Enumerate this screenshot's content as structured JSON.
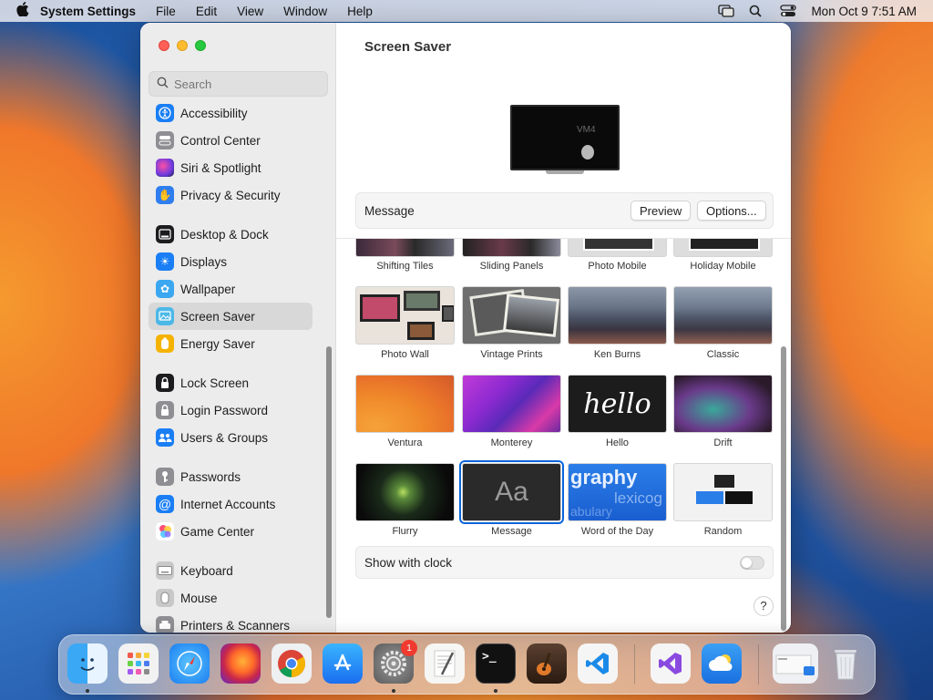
{
  "menubar": {
    "app": "System Settings",
    "menus": [
      "File",
      "Edit",
      "View",
      "Window",
      "Help"
    ],
    "clock": "Mon Oct 9  7:51 AM"
  },
  "sidebar": {
    "search_placeholder": "Search",
    "items": [
      {
        "label": "Accessibility",
        "icon": "accessibility-icon",
        "color": "#1a7ef5"
      },
      {
        "label": "Control Center",
        "icon": "control-center-icon",
        "color": "#8e8e93"
      },
      {
        "label": "Siri & Spotlight",
        "icon": "siri-icon",
        "color": "#7b3fe4"
      },
      {
        "label": "Privacy & Security",
        "icon": "hand-icon",
        "color": "#2f7ef0"
      },
      {
        "label": "Desktop & Dock",
        "icon": "dock-icon",
        "color": "#1c1c1e"
      },
      {
        "label": "Displays",
        "icon": "sun-icon",
        "color": "#1a7ef5"
      },
      {
        "label": "Wallpaper",
        "icon": "flower-icon",
        "color": "#3aa7f0"
      },
      {
        "label": "Screen Saver",
        "icon": "screen-saver-icon",
        "color": "#4cb8e8",
        "selected": true
      },
      {
        "label": "Energy Saver",
        "icon": "battery-icon",
        "color": "#f5b300"
      },
      {
        "label": "Lock Screen",
        "icon": "lock-icon",
        "color": "#1c1c1e"
      },
      {
        "label": "Login Password",
        "icon": "key-lock-icon",
        "color": "#8e8e93"
      },
      {
        "label": "Users & Groups",
        "icon": "users-icon",
        "color": "#1a7ef5"
      },
      {
        "label": "Passwords",
        "icon": "key-icon",
        "color": "#8e8e93"
      },
      {
        "label": "Internet Accounts",
        "icon": "at-icon",
        "color": "#1a7ef5"
      },
      {
        "label": "Game Center",
        "icon": "game-center-icon",
        "color": "#f5a623"
      },
      {
        "label": "Keyboard",
        "icon": "keyboard-icon",
        "color": "#9a9a9a"
      },
      {
        "label": "Mouse",
        "icon": "mouse-icon",
        "color": "#9a9a9a"
      },
      {
        "label": "Printers & Scanners",
        "icon": "printer-icon",
        "color": "#8e8e93"
      }
    ]
  },
  "main": {
    "title": "Screen Saver",
    "preview_text": "VM4",
    "message_label": "Message",
    "preview_button": "Preview",
    "options_button": "Options...",
    "top_row": [
      "Shifting Tiles",
      "Sliding Panels",
      "Photo Mobile",
      "Holiday Mobile"
    ],
    "savers": [
      {
        "label": "Photo Wall",
        "thumb": "photo-wall"
      },
      {
        "label": "Vintage Prints",
        "thumb": "vintage"
      },
      {
        "label": "Ken Burns",
        "thumb": "mountains"
      },
      {
        "label": "Classic",
        "thumb": "mountains2"
      },
      {
        "label": "Ventura",
        "thumb": "ventura"
      },
      {
        "label": "Monterey",
        "thumb": "monterey"
      },
      {
        "label": "Hello",
        "thumb": "hello",
        "text": "hello"
      },
      {
        "label": "Drift",
        "thumb": "drift"
      },
      {
        "label": "Flurry",
        "thumb": "flurry"
      },
      {
        "label": "Message",
        "thumb": "message",
        "text": "Aa",
        "selected": true
      },
      {
        "label": "Word of the Day",
        "thumb": "word",
        "text": "graphy"
      },
      {
        "label": "Random",
        "thumb": "random"
      }
    ],
    "show_clock_label": "Show with clock",
    "show_clock_on": false,
    "help": "?"
  },
  "dock": {
    "apps": [
      {
        "name": "finder",
        "glyph": "☺",
        "color": "#2d9cf0",
        "running": true
      },
      {
        "name": "launchpad",
        "glyph": "⠿",
        "color": "#f2f2f2"
      },
      {
        "name": "safari",
        "glyph": "✦",
        "color": "#1e8cf0"
      },
      {
        "name": "firefox",
        "glyph": "●",
        "color": "#6a2cd8"
      },
      {
        "name": "chrome",
        "glyph": "◉",
        "color": "#e9e9e9"
      },
      {
        "name": "app-store",
        "glyph": "A",
        "color": "#1a8cf0"
      },
      {
        "name": "system-settings",
        "glyph": "⚙",
        "color": "#8a8a8a",
        "running": true,
        "badge": "1"
      },
      {
        "name": "textedit",
        "glyph": "✎",
        "color": "#f4f4f4"
      },
      {
        "name": "terminal",
        "glyph": ">_",
        "color": "#111111",
        "running": true
      },
      {
        "name": "garageband",
        "glyph": "♪",
        "color": "#3a2a20"
      },
      {
        "name": "vscode",
        "glyph": "⟩",
        "color": "#f5f5f5"
      },
      {
        "name": "visual-studio",
        "glyph": "◣",
        "color": "#f5f5f5"
      },
      {
        "name": "weather",
        "glyph": "☁",
        "color": "#2e86e8"
      },
      {
        "name": "preview-window",
        "glyph": "▭",
        "color": "#eef0f4"
      },
      {
        "name": "trash",
        "glyph": "🗑",
        "color": "#e6e8ec"
      }
    ]
  }
}
